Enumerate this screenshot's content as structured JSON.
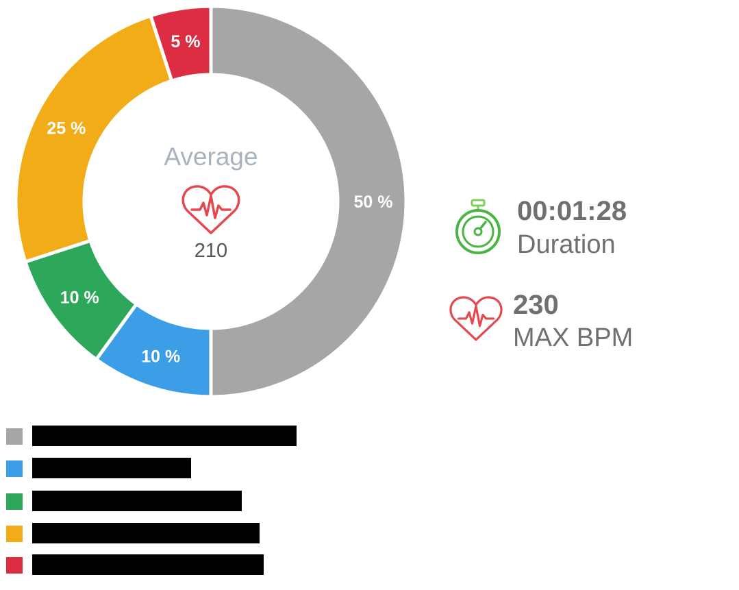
{
  "chart_data": {
    "type": "pie",
    "variant": "donut",
    "categories": [
      "",
      "",
      "",
      "",
      ""
    ],
    "values": [
      50,
      10,
      10,
      25,
      5
    ],
    "data_labels": [
      "50 %",
      "10 %",
      "10 %",
      "25 %",
      "5 %"
    ],
    "colors": [
      "#a6a6a6",
      "#3b9ee6",
      "#2da85a",
      "#f2ac17",
      "#dc2d42"
    ],
    "legend_position": "bottom-left",
    "center_title": "Average",
    "center_value": "210"
  },
  "stats": {
    "duration": {
      "value": "00:01:28",
      "label": "Duration",
      "icon": "stopwatch-icon",
      "color": "#4bb543"
    },
    "max_bpm": {
      "value": "230",
      "label": "MAX BPM",
      "icon": "heart-rate-icon",
      "color": "#e5484d"
    }
  },
  "legend": {
    "items": [
      {
        "swatch": "#a6a6a6",
        "label": ""
      },
      {
        "swatch": "#3b9ee6",
        "label": ""
      },
      {
        "swatch": "#2da85a",
        "label": ""
      },
      {
        "swatch": "#f2ac17",
        "label": ""
      },
      {
        "swatch": "#dc2d42",
        "label": ""
      }
    ]
  }
}
